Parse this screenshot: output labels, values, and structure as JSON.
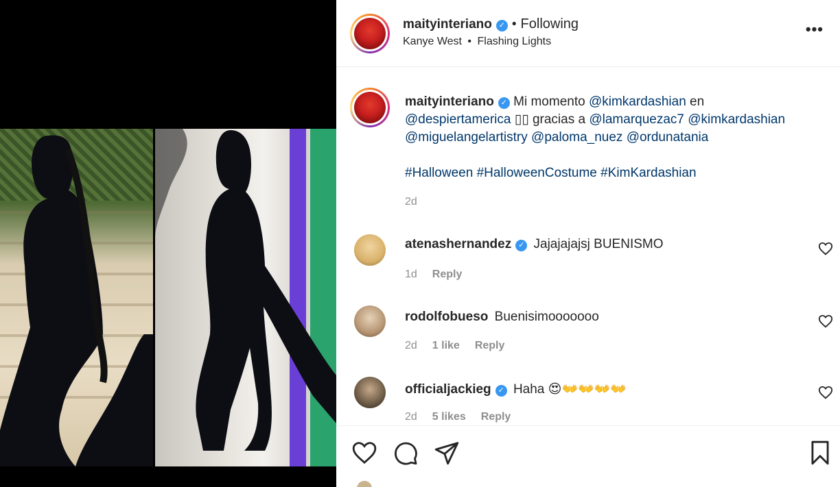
{
  "post": {
    "author": "maityinteriano",
    "following_label": "Following",
    "separator": "•",
    "audio_artist": "Kanye West",
    "audio_track": "Flashing Lights",
    "more_label": "•••"
  },
  "caption": {
    "username": "maityinteriano",
    "text_intro": "Mi momento",
    "mention_1": "@kimkardashian",
    "text_en": "en",
    "mention_2": "@despiertamerica",
    "emoji": "▯▯",
    "text_gracias": "gracias a",
    "mention_3": "@lamarquezac7",
    "mention_4": "@kimkardashian",
    "mention_5": "@miguelangelartistry",
    "mention_6": "@paloma_nuez",
    "mention_7": "@ordunatania",
    "hashtags": "#Halloween #HalloweenCostume #KimKardashian",
    "age": "2d"
  },
  "comments": [
    {
      "username": "atenashernandez",
      "verified": true,
      "text": "Jajajajajsj BUENISMO",
      "age": "1d",
      "likes": "",
      "reply_label": "Reply",
      "avatar_color": "#d9b26b"
    },
    {
      "username": "rodolfobueso",
      "verified": false,
      "text": "Buenisimooooooo",
      "age": "2d",
      "likes": "1 like",
      "reply_label": "Reply",
      "avatar_color": "#b59573"
    },
    {
      "username": "officialjackieg",
      "verified": true,
      "text": "Haha 😍👐👐👐👐",
      "age": "2d",
      "likes": "5 likes",
      "reply_label": "Reply",
      "avatar_color": "#6b5a45"
    }
  ],
  "icons": {
    "like": "heart-icon",
    "comment": "comment-icon",
    "share": "share-icon",
    "save": "bookmark-icon",
    "verified": "verified-icon",
    "more": "more-icon"
  },
  "colors": {
    "link": "#00376b",
    "verified": "#3897f0",
    "muted": "#8e8e8e",
    "text": "#262626"
  }
}
